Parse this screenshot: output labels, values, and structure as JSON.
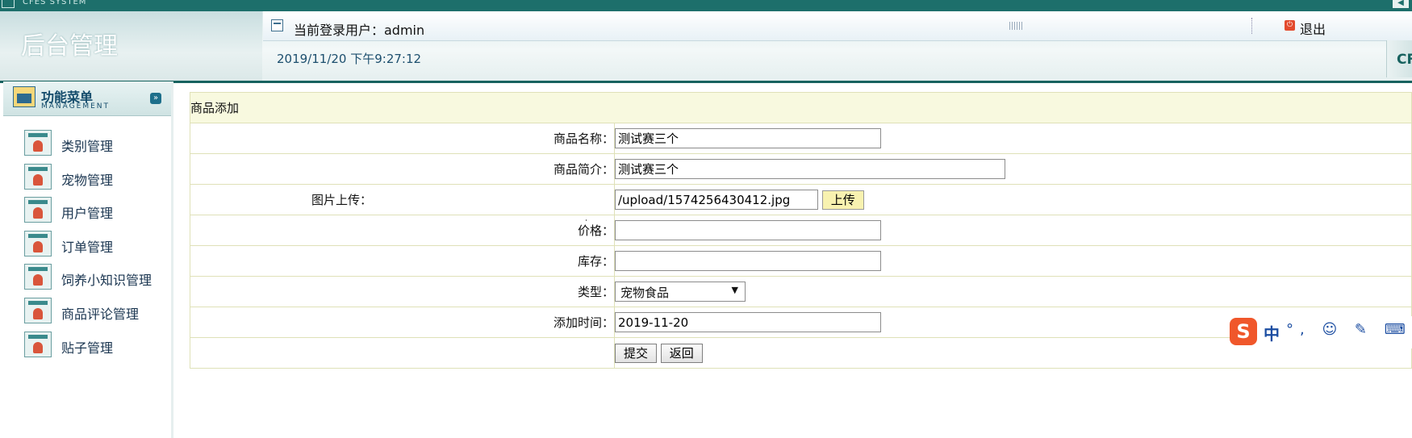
{
  "system": {
    "name": "CFES SYSTEM",
    "corner_icon": "scroll-arrow-icon"
  },
  "header": {
    "brand_title": "后台管理",
    "user_label": "当前登录用户：admin",
    "datetime": "2019/11/20 下午9:27:12",
    "logout_label": "退出",
    "side_text": "CF"
  },
  "sidebar": {
    "title": "功能菜单",
    "subtitle": "MANAGEMENT",
    "items": [
      {
        "label": "类别管理"
      },
      {
        "label": "宠物管理"
      },
      {
        "label": "用户管理"
      },
      {
        "label": "订单管理"
      },
      {
        "label": "饲养小知识管理"
      },
      {
        "label": "商品评论管理"
      },
      {
        "label": "贴子管理"
      }
    ]
  },
  "form": {
    "caption": "商品添加",
    "name_label": "商品名称：",
    "name_value": "测试赛三个",
    "intro_label": "商品简介：",
    "intro_value": "测试赛三个",
    "image_label": "图片上传：",
    "image_value": "/upload/1574256430412.jpg",
    "upload_button": "上传",
    "price_label": "价格：",
    "price_value": "",
    "stock_label": "库存：",
    "stock_value": "",
    "type_label": "类型：",
    "type_selected": "宠物食品",
    "time_label": "添加时间：",
    "time_value": "2019-11-20",
    "submit_button": "提交",
    "back_button": "返回"
  },
  "ime": {
    "logo": "S",
    "mode": "中",
    "icons": "°, ☺ ✎ ⌨"
  }
}
